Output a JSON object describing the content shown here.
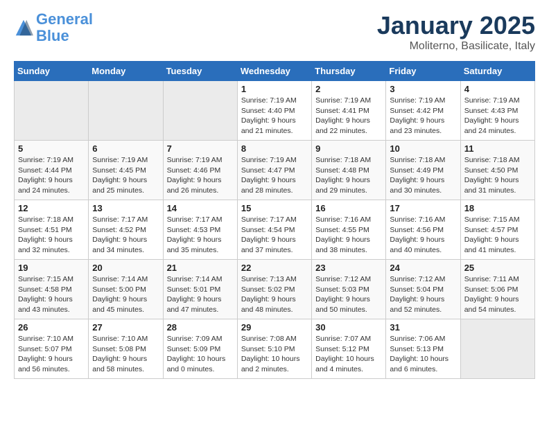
{
  "header": {
    "logo_line1": "General",
    "logo_line2": "Blue",
    "month": "January 2025",
    "location": "Moliterno, Basilicate, Italy"
  },
  "days_of_week": [
    "Sunday",
    "Monday",
    "Tuesday",
    "Wednesday",
    "Thursday",
    "Friday",
    "Saturday"
  ],
  "weeks": [
    [
      {
        "day": "",
        "info": ""
      },
      {
        "day": "",
        "info": ""
      },
      {
        "day": "",
        "info": ""
      },
      {
        "day": "1",
        "info": "Sunrise: 7:19 AM\nSunset: 4:40 PM\nDaylight: 9 hours and 21 minutes."
      },
      {
        "day": "2",
        "info": "Sunrise: 7:19 AM\nSunset: 4:41 PM\nDaylight: 9 hours and 22 minutes."
      },
      {
        "day": "3",
        "info": "Sunrise: 7:19 AM\nSunset: 4:42 PM\nDaylight: 9 hours and 23 minutes."
      },
      {
        "day": "4",
        "info": "Sunrise: 7:19 AM\nSunset: 4:43 PM\nDaylight: 9 hours and 24 minutes."
      }
    ],
    [
      {
        "day": "5",
        "info": "Sunrise: 7:19 AM\nSunset: 4:44 PM\nDaylight: 9 hours and 24 minutes."
      },
      {
        "day": "6",
        "info": "Sunrise: 7:19 AM\nSunset: 4:45 PM\nDaylight: 9 hours and 25 minutes."
      },
      {
        "day": "7",
        "info": "Sunrise: 7:19 AM\nSunset: 4:46 PM\nDaylight: 9 hours and 26 minutes."
      },
      {
        "day": "8",
        "info": "Sunrise: 7:19 AM\nSunset: 4:47 PM\nDaylight: 9 hours and 28 minutes."
      },
      {
        "day": "9",
        "info": "Sunrise: 7:18 AM\nSunset: 4:48 PM\nDaylight: 9 hours and 29 minutes."
      },
      {
        "day": "10",
        "info": "Sunrise: 7:18 AM\nSunset: 4:49 PM\nDaylight: 9 hours and 30 minutes."
      },
      {
        "day": "11",
        "info": "Sunrise: 7:18 AM\nSunset: 4:50 PM\nDaylight: 9 hours and 31 minutes."
      }
    ],
    [
      {
        "day": "12",
        "info": "Sunrise: 7:18 AM\nSunset: 4:51 PM\nDaylight: 9 hours and 32 minutes."
      },
      {
        "day": "13",
        "info": "Sunrise: 7:17 AM\nSunset: 4:52 PM\nDaylight: 9 hours and 34 minutes."
      },
      {
        "day": "14",
        "info": "Sunrise: 7:17 AM\nSunset: 4:53 PM\nDaylight: 9 hours and 35 minutes."
      },
      {
        "day": "15",
        "info": "Sunrise: 7:17 AM\nSunset: 4:54 PM\nDaylight: 9 hours and 37 minutes."
      },
      {
        "day": "16",
        "info": "Sunrise: 7:16 AM\nSunset: 4:55 PM\nDaylight: 9 hours and 38 minutes."
      },
      {
        "day": "17",
        "info": "Sunrise: 7:16 AM\nSunset: 4:56 PM\nDaylight: 9 hours and 40 minutes."
      },
      {
        "day": "18",
        "info": "Sunrise: 7:15 AM\nSunset: 4:57 PM\nDaylight: 9 hours and 41 minutes."
      }
    ],
    [
      {
        "day": "19",
        "info": "Sunrise: 7:15 AM\nSunset: 4:58 PM\nDaylight: 9 hours and 43 minutes."
      },
      {
        "day": "20",
        "info": "Sunrise: 7:14 AM\nSunset: 5:00 PM\nDaylight: 9 hours and 45 minutes."
      },
      {
        "day": "21",
        "info": "Sunrise: 7:14 AM\nSunset: 5:01 PM\nDaylight: 9 hours and 47 minutes."
      },
      {
        "day": "22",
        "info": "Sunrise: 7:13 AM\nSunset: 5:02 PM\nDaylight: 9 hours and 48 minutes."
      },
      {
        "day": "23",
        "info": "Sunrise: 7:12 AM\nSunset: 5:03 PM\nDaylight: 9 hours and 50 minutes."
      },
      {
        "day": "24",
        "info": "Sunrise: 7:12 AM\nSunset: 5:04 PM\nDaylight: 9 hours and 52 minutes."
      },
      {
        "day": "25",
        "info": "Sunrise: 7:11 AM\nSunset: 5:06 PM\nDaylight: 9 hours and 54 minutes."
      }
    ],
    [
      {
        "day": "26",
        "info": "Sunrise: 7:10 AM\nSunset: 5:07 PM\nDaylight: 9 hours and 56 minutes."
      },
      {
        "day": "27",
        "info": "Sunrise: 7:10 AM\nSunset: 5:08 PM\nDaylight: 9 hours and 58 minutes."
      },
      {
        "day": "28",
        "info": "Sunrise: 7:09 AM\nSunset: 5:09 PM\nDaylight: 10 hours and 0 minutes."
      },
      {
        "day": "29",
        "info": "Sunrise: 7:08 AM\nSunset: 5:10 PM\nDaylight: 10 hours and 2 minutes."
      },
      {
        "day": "30",
        "info": "Sunrise: 7:07 AM\nSunset: 5:12 PM\nDaylight: 10 hours and 4 minutes."
      },
      {
        "day": "31",
        "info": "Sunrise: 7:06 AM\nSunset: 5:13 PM\nDaylight: 10 hours and 6 minutes."
      },
      {
        "day": "",
        "info": ""
      }
    ]
  ]
}
